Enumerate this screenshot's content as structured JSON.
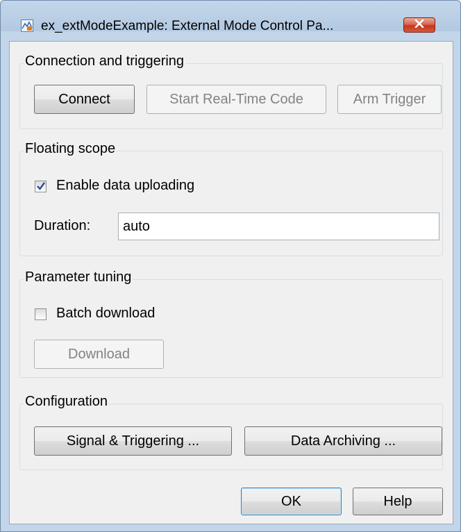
{
  "window": {
    "title": "ex_extModeExample: External Mode Control Pa..."
  },
  "icons": {
    "app": "simulink-model-icon",
    "close": "close-icon",
    "check": "checkmark-icon"
  },
  "connection": {
    "title": "Connection and triggering",
    "connect_label": "Connect",
    "start_label": "Start Real-Time Code",
    "arm_label": "Arm Trigger"
  },
  "floating_scope": {
    "title": "Floating scope",
    "enable_label": "Enable data uploading",
    "enable_checked": true,
    "duration_label": "Duration:",
    "duration_value": "auto"
  },
  "parameter_tuning": {
    "title": "Parameter tuning",
    "batch_label": "Batch download",
    "batch_checked": false,
    "download_label": "Download"
  },
  "configuration": {
    "title": "Configuration",
    "signal_label": "Signal & Triggering ...",
    "archiving_label": "Data Archiving ..."
  },
  "footer": {
    "ok_label": "OK",
    "help_label": "Help"
  }
}
